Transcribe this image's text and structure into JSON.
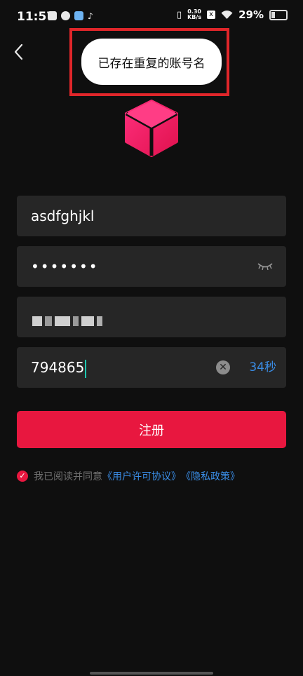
{
  "status_bar": {
    "time": "11:57",
    "speed_value": "0.30",
    "speed_unit": "KB/s",
    "battery": "29%"
  },
  "toast": {
    "message": "已存在重复的账号名"
  },
  "form": {
    "username": "asdfghjkl",
    "password_mask": "•••••••",
    "code": "794865",
    "countdown": "34秒",
    "register_label": "注册"
  },
  "agreement": {
    "prefix": "我已阅读并同意",
    "user_agreement": "《用户许可协议》",
    "privacy_policy": "《隐私政策》"
  },
  "colors": {
    "background": "#0f0f0f",
    "field": "#262626",
    "accent": "#e8173f",
    "link": "#3a8de6",
    "toast_highlight": "#e0262a"
  }
}
